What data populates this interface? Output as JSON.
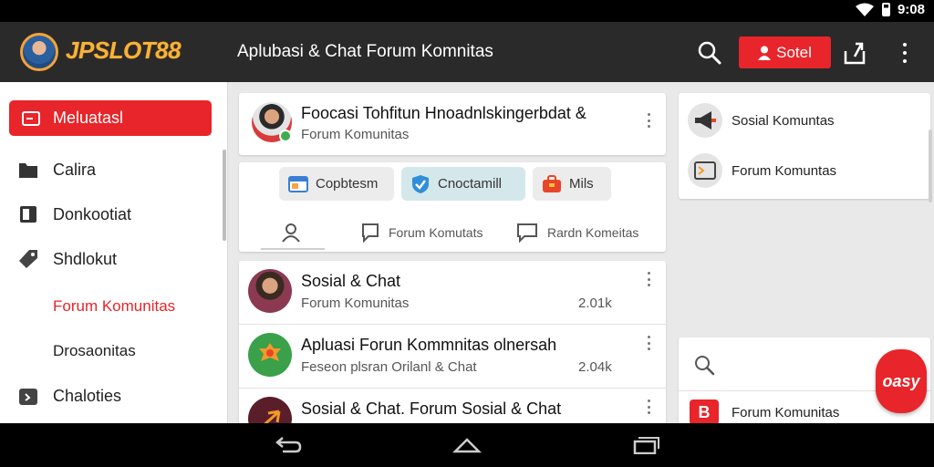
{
  "status_bar": {
    "time": "9:08"
  },
  "app_bar": {
    "brand": "JPSLOT88",
    "title": "Aplubasi & Chat Forum Komnitas",
    "primary_button": "Sotel"
  },
  "sidebar": {
    "active_item": "Meluatasl",
    "items": [
      {
        "label": "Calira",
        "icon": "folder-icon"
      },
      {
        "label": "Donkootiat",
        "icon": "document-icon"
      },
      {
        "label": "Shdlokut",
        "icon": "tag-icon"
      }
    ],
    "sub_items": [
      {
        "label": "Forum Komunitas",
        "highlight": true
      },
      {
        "label": "Drosaonitas",
        "highlight": false
      }
    ],
    "bottom_item": {
      "label": "Chaloties",
      "icon": "calendar-icon"
    }
  },
  "profile_card": {
    "title": "Foocasi Tohfitun Hnoadnlskingerbdat &",
    "subtitle": "Forum Komunitas"
  },
  "chips": [
    {
      "label": "Copbtesm",
      "icon": "window-icon",
      "color": "#3b7fd4"
    },
    {
      "label": "Cnoctamill",
      "icon": "shield-check-icon",
      "color": "#2f8fd8"
    },
    {
      "label": "Mils",
      "icon": "bag-icon",
      "color": "#e8452a"
    }
  ],
  "tabs": [
    {
      "label": "",
      "icon": "person-icon"
    },
    {
      "label": "Forum Komutats",
      "icon": "chat-square-icon"
    },
    {
      "label": "Rardn Komeitas",
      "icon": "message-icon"
    }
  ],
  "feed": [
    {
      "title": "Sosial & Chat",
      "subtitle": "Forum Komunitas",
      "meta": "2.01k"
    },
    {
      "title": "Apluasi Forun Kommnitas olnersah",
      "subtitle": "Feseon plsran Orilanl & Chat",
      "meta": "2.04k"
    },
    {
      "title": "Sosial & Chat. Forum Sosial & Chat",
      "subtitle": "",
      "meta": ""
    }
  ],
  "right_panel": {
    "items": [
      {
        "label": "Sosial Komuntas",
        "icon": "megaphone-icon"
      },
      {
        "label": "Forum Komuntas",
        "icon": "image-icon"
      }
    ],
    "bottom_item": {
      "label": "Forum Komunitas",
      "icon_text": "B"
    },
    "fab_label": "oasy"
  },
  "colors": {
    "accent": "#e8252a",
    "brand": "#f6b23a",
    "appbar": "#2a2a2a"
  }
}
